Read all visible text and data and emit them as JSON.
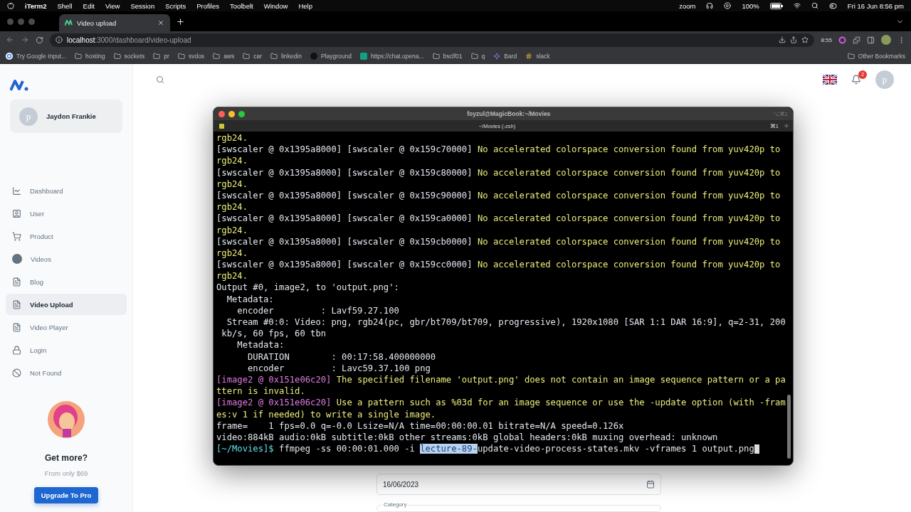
{
  "menu_bar": {
    "app": "iTerm2",
    "menus": [
      "Shell",
      "Edit",
      "View",
      "Session",
      "Scripts",
      "Profiles",
      "Toolbelt",
      "Window",
      "Help"
    ],
    "zoom": "zoom",
    "battery": "100%",
    "clock": "Fri 16 Jun  8:56 pm"
  },
  "browser": {
    "tabs": [
      {
        "title": "Video upload",
        "selected": true
      }
    ],
    "url": {
      "host": "localhost",
      "path": ":3000/dashboard/video-upload"
    },
    "extension_badge": "8:55",
    "bookmarks": [
      {
        "label": "Try Google Input...",
        "kind": "google"
      },
      {
        "label": "hosting",
        "kind": "folder"
      },
      {
        "label": "sockets",
        "kind": "folder"
      },
      {
        "label": "pr",
        "kind": "folder"
      },
      {
        "label": "svdos",
        "kind": "folder"
      },
      {
        "label": "aws",
        "kind": "folder"
      },
      {
        "label": "car",
        "kind": "folder"
      },
      {
        "label": "linkedin",
        "kind": "folder"
      },
      {
        "label": "Playground",
        "kind": "dark"
      },
      {
        "label": "https://chat.opena...",
        "kind": "chat"
      },
      {
        "label": "bsclf01",
        "kind": "folder"
      },
      {
        "label": "q",
        "kind": "folder"
      },
      {
        "label": "Bard",
        "kind": "sparkle"
      },
      {
        "label": "slack",
        "kind": "slack"
      }
    ],
    "other_bookmarks": "Other Bookmarks"
  },
  "sidebar": {
    "user": {
      "initial": "p",
      "name": "Jaydon Frankie"
    },
    "items": [
      {
        "label": "Dashboard",
        "kind": "chart",
        "selected": false
      },
      {
        "label": "User",
        "kind": "user",
        "selected": false
      },
      {
        "label": "Product",
        "kind": "cart",
        "selected": false
      },
      {
        "label": "Videos",
        "kind": "dot",
        "selected": false
      },
      {
        "label": "Blog",
        "kind": "doc",
        "selected": false
      },
      {
        "label": "Video Upload",
        "kind": "doc",
        "selected": true
      },
      {
        "label": "Video Player",
        "kind": "doc",
        "selected": false
      },
      {
        "label": "Login",
        "kind": "lock",
        "selected": false
      },
      {
        "label": "Not Found",
        "kind": "ban",
        "selected": false
      }
    ],
    "promo": {
      "title": "Get more?",
      "subtitle": "From only $69",
      "button": "Upgrade To Pro"
    }
  },
  "header": {
    "notifications": "2",
    "avatar_initial": "p"
  },
  "form": {
    "date": {
      "value": "16/06/2023"
    },
    "category": {
      "label": "Category"
    }
  },
  "terminal": {
    "title": "foyzul@MagicBook:~/Movies",
    "shortcut": "⌥⌘1",
    "tab": {
      "title": "~/Movies (-zsh)",
      "shortcut": "⌘1"
    },
    "lines": [
      [
        {
          "kind": "warn",
          "text": "rgb24."
        }
      ],
      [
        {
          "kind": "plain",
          "text": "[swscaler @ 0x1395a8000] [swscaler @ 0x159c70000] "
        },
        {
          "kind": "warn",
          "text": "No accelerated colorspace conversion found from yuv420p to"
        }
      ],
      [
        {
          "kind": "warn",
          "text": "rgb24."
        }
      ],
      [
        {
          "kind": "plain",
          "text": "[swscaler @ 0x1395a8000] [swscaler @ 0x159c80000] "
        },
        {
          "kind": "warn",
          "text": "No accelerated colorspace conversion found from yuv420p to"
        }
      ],
      [
        {
          "kind": "warn",
          "text": "rgb24."
        }
      ],
      [
        {
          "kind": "plain",
          "text": "[swscaler @ 0x1395a8000] [swscaler @ 0x159c90000] "
        },
        {
          "kind": "warn",
          "text": "No accelerated colorspace conversion found from yuv420p to"
        }
      ],
      [
        {
          "kind": "warn",
          "text": "rgb24."
        }
      ],
      [
        {
          "kind": "plain",
          "text": "[swscaler @ 0x1395a8000] [swscaler @ 0x159ca0000] "
        },
        {
          "kind": "warn",
          "text": "No accelerated colorspace conversion found from yuv420p to"
        }
      ],
      [
        {
          "kind": "warn",
          "text": "rgb24."
        }
      ],
      [
        {
          "kind": "plain",
          "text": "[swscaler @ 0x1395a8000] [swscaler @ 0x159cb0000] "
        },
        {
          "kind": "warn",
          "text": "No accelerated colorspace conversion found from yuv420p to"
        }
      ],
      [
        {
          "kind": "warn",
          "text": "rgb24."
        }
      ],
      [
        {
          "kind": "plain",
          "text": "[swscaler @ 0x1395a8000] [swscaler @ 0x159cc0000] "
        },
        {
          "kind": "warn",
          "text": "No accelerated colorspace conversion found from yuv420p to"
        }
      ],
      [
        {
          "kind": "warn",
          "text": "rgb24."
        }
      ],
      [
        {
          "kind": "plain",
          "text": "Output #0, image2, to 'output.png':"
        }
      ],
      [
        {
          "kind": "plain",
          "text": "  Metadata:"
        }
      ],
      [
        {
          "kind": "plain",
          "text": "    encoder         : Lavf59.27.100"
        }
      ],
      [
        {
          "kind": "plain",
          "text": "  Stream #0:0: Video: png, rgb24(pc, gbr/bt709/bt709, progressive), 1920x1080 [SAR 1:1 DAR 16:9], q=2-31, 200"
        }
      ],
      [
        {
          "kind": "plain",
          "text": " kb/s, 60 fps, 60 tbn"
        }
      ],
      [
        {
          "kind": "plain",
          "text": "    Metadata:"
        }
      ],
      [
        {
          "kind": "plain",
          "text": "      DURATION        : 00:17:58.400000000"
        }
      ],
      [
        {
          "kind": "plain",
          "text": "      encoder         : Lavc59.37.100 png"
        }
      ],
      [
        {
          "kind": "tag",
          "text": "[image2 @ 0x151e06c20]"
        },
        {
          "kind": "warn",
          "text": " The specified filename 'output.png' does not contain an image sequence pattern or a pa"
        }
      ],
      [
        {
          "kind": "warn",
          "text": "ttern is invalid."
        }
      ],
      [
        {
          "kind": "tag",
          "text": "[image2 @ 0x151e06c20]"
        },
        {
          "kind": "warn",
          "text": " Use a pattern such as %03d for an image sequence or use the -update option (with -fram"
        }
      ],
      [
        {
          "kind": "warn",
          "text": "es:v 1 if needed) to write a single image."
        }
      ],
      [
        {
          "kind": "plain",
          "text": "frame=    1 fps=0.0 q=-0.0 Lsize=N/A time=00:00:00.01 bitrate=N/A speed=0.126x"
        }
      ],
      [
        {
          "kind": "plain",
          "text": "video:884kB audio:0kB subtitle:0kB other streams:0kB global headers:0kB muxing overhead: unknown"
        }
      ],
      [
        {
          "kind": "prompt",
          "text": "[~/Movies]$"
        },
        {
          "kind": "plain",
          "text": " ffmpeg -ss 00:00:01.000 -i "
        },
        {
          "kind": "selected",
          "text": "lecture-89-"
        },
        {
          "kind": "plain",
          "text": "update-video-process-states.mkv -vframes 1 output.png"
        }
      ]
    ]
  }
}
